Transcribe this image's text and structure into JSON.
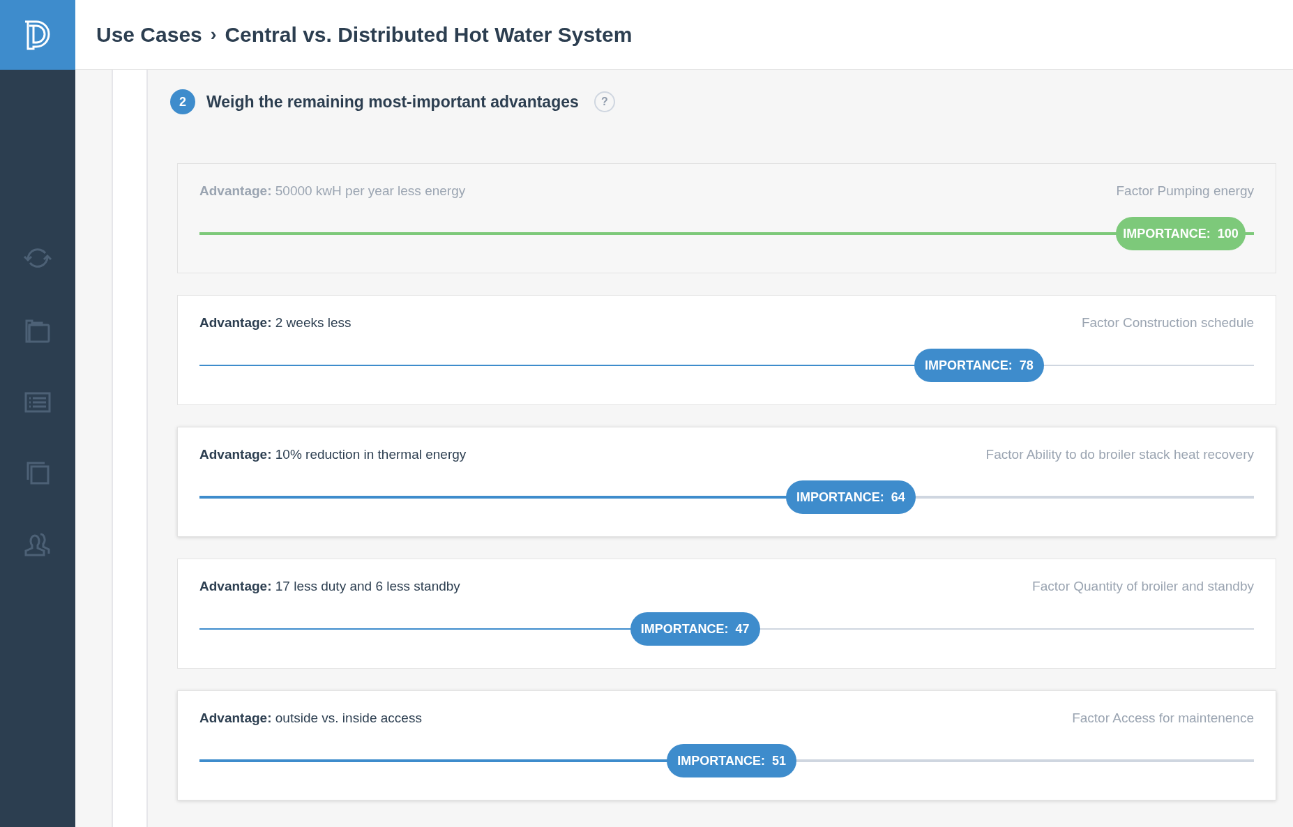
{
  "breadcrumb": {
    "parent": "Use Cases",
    "separator": "›",
    "current": "Central vs. Distributed Hot Water System"
  },
  "step": {
    "number": "2",
    "title": "Weigh the remaining most-important advantages",
    "help": "?"
  },
  "advantages": [
    {
      "label": "Advantage:",
      "text": "50000 kwH per year less energy",
      "factor": "Factor Pumping energy",
      "importance": "IMPORTANCE:  100",
      "level": 1.0,
      "completed": true,
      "highlighted": false
    },
    {
      "label": "Advantage:",
      "text": "2 weeks less",
      "factor": "Factor Construction schedule",
      "importance": "IMPORTANCE:  78",
      "level": 0.78,
      "completed": false,
      "highlighted": false
    },
    {
      "label": "Advantage:",
      "text": "10% reduction in thermal energy",
      "factor": "Factor Ability to do broiler stack heat recovery",
      "importance": "IMPORTANCE:  64",
      "level": 0.64,
      "completed": false,
      "highlighted": true
    },
    {
      "label": "Advantage:",
      "text": "17 less duty and 6 less standby",
      "factor": "Factor Quantity of broiler and standby",
      "importance": "IMPORTANCE:  47",
      "level": 0.47,
      "completed": false,
      "highlighted": false
    },
    {
      "label": "Advantage:",
      "text": "outside vs. inside access",
      "factor": "Factor Access for maintenence",
      "importance": "IMPORTANCE:  51",
      "level": 0.51,
      "completed": false,
      "highlighted": true
    }
  ]
}
